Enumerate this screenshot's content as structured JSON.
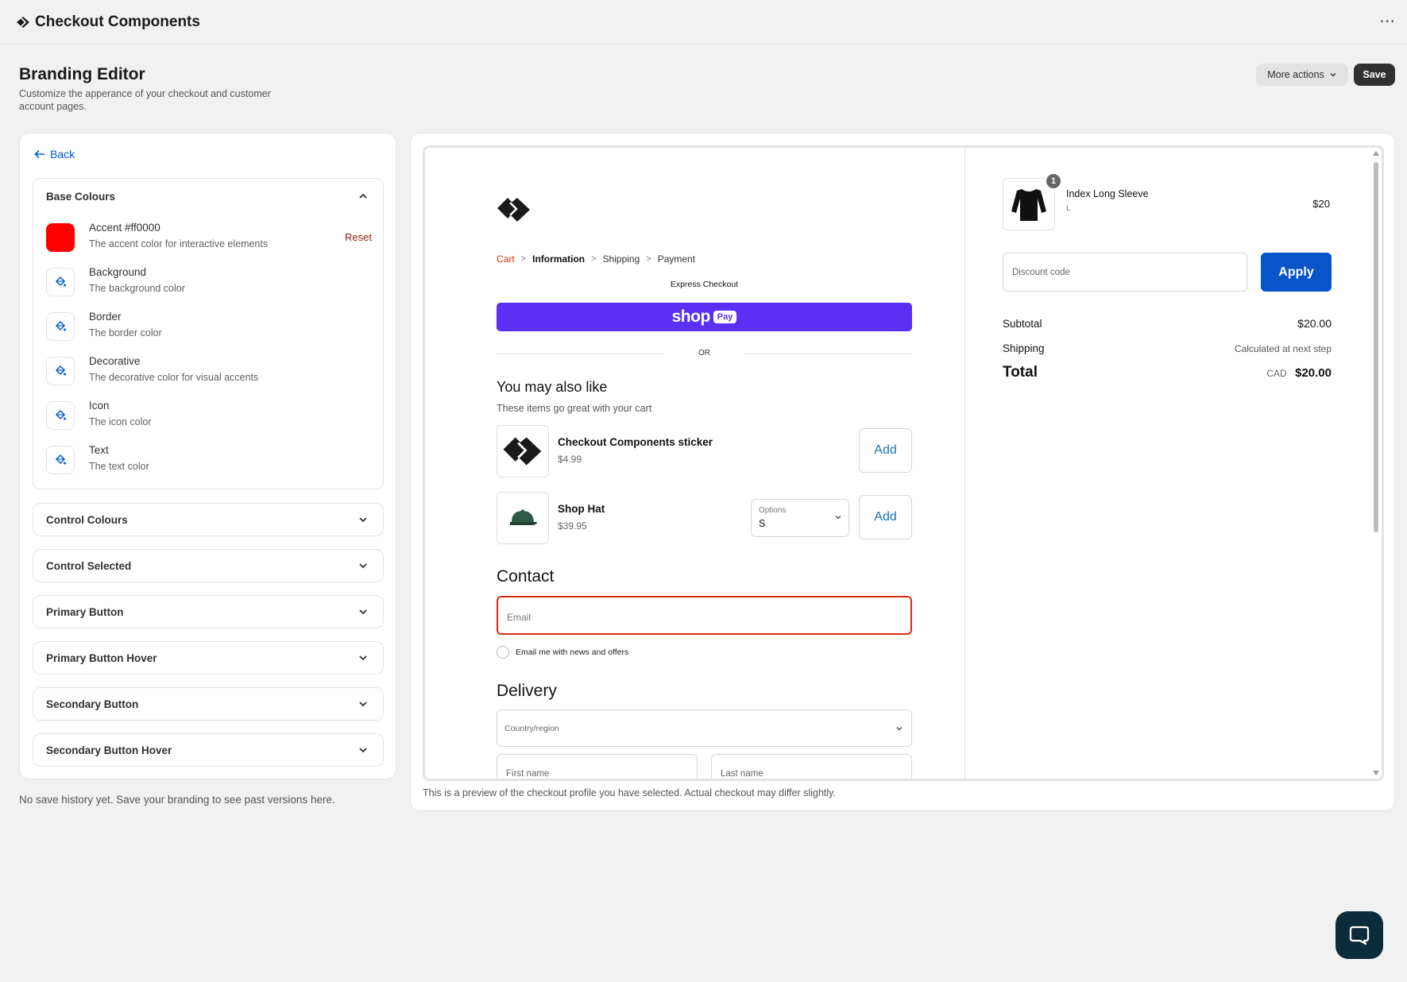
{
  "app": {
    "title": "Checkout Components",
    "more_icon": "⋯"
  },
  "page": {
    "title": "Branding Editor",
    "subtitle": "Customize the apperance of your checkout and customer account pages.",
    "more_actions_label": "More actions",
    "save_label": "Save"
  },
  "sidebar": {
    "back_label": "Back",
    "base": {
      "title": "Base Colours",
      "accent_color": "#ff0000",
      "rows": [
        {
          "title": "Accent #ff0000",
          "desc": "The accent color for interactive elements",
          "reset": "Reset"
        },
        {
          "title": "Background",
          "desc": "The background color"
        },
        {
          "title": "Border",
          "desc": "The border color"
        },
        {
          "title": "Decorative",
          "desc": "The decorative color for visual accents"
        },
        {
          "title": "Icon",
          "desc": "The icon color"
        },
        {
          "title": "Text",
          "desc": "The text color"
        }
      ]
    },
    "sections": [
      "Control Colours",
      "Control Selected",
      "Primary Button",
      "Primary Button Hover",
      "Secondary Button",
      "Secondary Button Hover"
    ],
    "history_note": "No save history yet. Save your branding to see past versions here."
  },
  "preview": {
    "note": "This is a preview of the checkout profile you have selected. Actual checkout may differ slightly.",
    "breadcrumbs": [
      "Cart",
      "Information",
      "Shipping",
      "Payment"
    ],
    "breadcrumb_sep": ">",
    "express_label": "Express Checkout",
    "shop_pay": {
      "word": "shop",
      "badge": "Pay",
      "color": "#5a31f4"
    },
    "or_label": "OR",
    "upsell": {
      "title": "You may also like",
      "subtitle": "These items go great with your cart",
      "items": [
        {
          "name": "Checkout Components sticker",
          "price": "$4.99",
          "add": "Add"
        },
        {
          "name": "Shop Hat",
          "price": "$39.95",
          "add": "Add",
          "options_label": "Options",
          "options_value": "S"
        }
      ]
    },
    "contact": {
      "title": "Contact",
      "email_placeholder": "Email",
      "news_label": "Email me with news and offers"
    },
    "delivery": {
      "title": "Delivery",
      "country_placeholder": "Country/region",
      "first_name": "First name",
      "last_name": "Last name"
    },
    "summary": {
      "item_qty": "1",
      "item_name": "Index Long Sleeve",
      "item_variant": "L",
      "item_price": "$20",
      "discount_placeholder": "Discount code",
      "apply_label": "Apply",
      "subtotal_label": "Subtotal",
      "subtotal_value": "$20.00",
      "shipping_label": "Shipping",
      "shipping_value": "Calculated at next step",
      "total_label": "Total",
      "total_currency": "CAD",
      "total_value": "$20.00"
    }
  },
  "colors": {
    "accent": "#ff0000",
    "primary_blue": "#0a54c9",
    "link": "#005bd3"
  }
}
